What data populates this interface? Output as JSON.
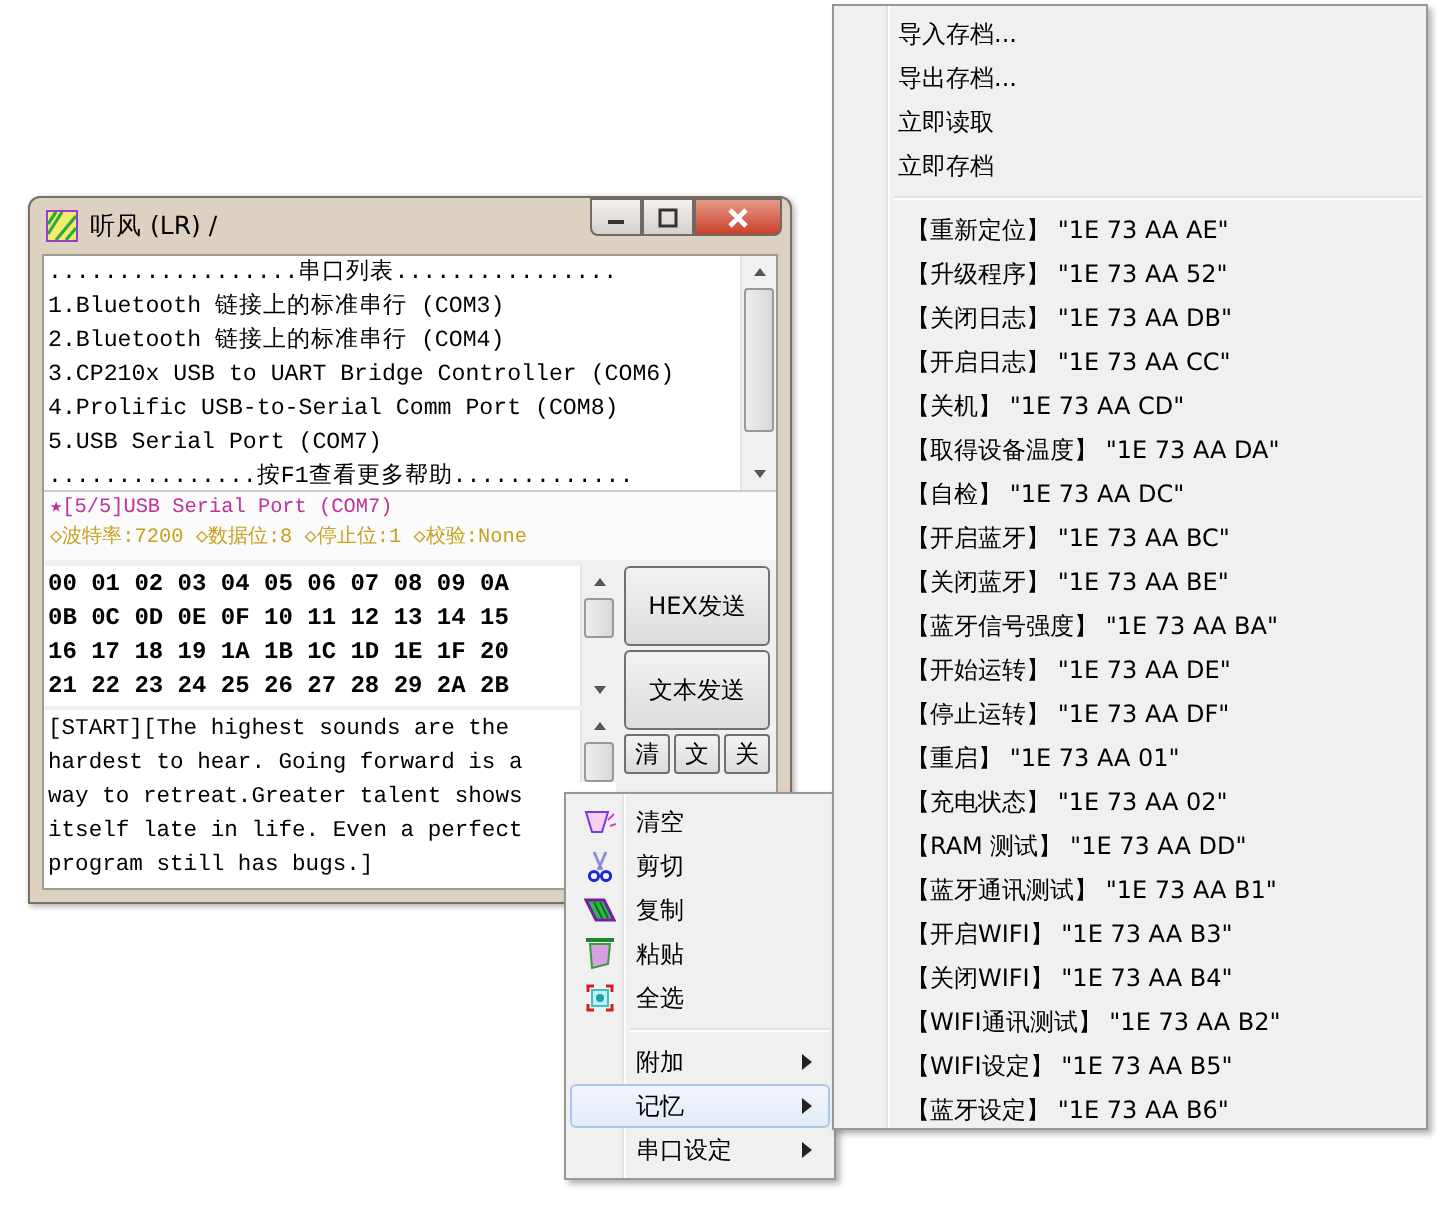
{
  "window": {
    "title": "听风 (LR)  /",
    "port_list": {
      "lines": [
        "..................串口列表................",
        "1.Bluetooth 链接上的标准串行 (COM3)",
        "2.Bluetooth 链接上的标准串行 (COM4)",
        "3.CP210x USB to UART Bridge Controller (COM6)",
        "4.Prolific USB-to-Serial Comm Port (COM8)",
        "5.USB Serial Port (COM7)",
        "...............按F1查看更多帮助............."
      ]
    },
    "status": {
      "port": "★[5/5]USB Serial Port (COM7)",
      "params": "◇波特率:7200 ◇数据位:8 ◇停止位:1 ◇校验:None"
    },
    "hex_box": {
      "lines": [
        "00 01 02 03 04 05 06 07 08 09 0A",
        "0B 0C 0D 0E 0F 10 11 12 13 14 15",
        "16 17 18 19 1A 1B 1C 1D 1E 1F 20",
        "21 22 23 24 25 26 27 28 29 2A 2B"
      ]
    },
    "text_box": {
      "text": "[START][The highest sounds are the hardest to hear. Going forward is a way to retreat.Greater talent shows itself late in life. Even a perfect program still has bugs.]"
    },
    "send_buttons": [
      {
        "label": "HEX发送"
      },
      {
        "label": "文本发送"
      }
    ],
    "small_buttons": [
      {
        "label": "清"
      },
      {
        "label": "文"
      },
      {
        "label": "关"
      }
    ]
  },
  "context_menu": {
    "items": [
      {
        "label": "清空",
        "kind": "action",
        "selected": false
      },
      {
        "label": "剪切",
        "kind": "action",
        "selected": false
      },
      {
        "label": "复制",
        "kind": "action",
        "selected": false
      },
      {
        "label": "粘贴",
        "kind": "action",
        "selected": false
      },
      {
        "label": "全选",
        "kind": "action",
        "selected": false
      },
      {
        "kind": "separator"
      },
      {
        "label": "附加",
        "kind": "submenu",
        "selected": false
      },
      {
        "label": "记忆",
        "kind": "submenu",
        "selected": true
      },
      {
        "label": "串口设定",
        "kind": "submenu",
        "selected": false
      }
    ]
  },
  "submenu": {
    "items": [
      {
        "label": "导入存档...",
        "kind": "plain"
      },
      {
        "label": "导出存档...",
        "kind": "plain"
      },
      {
        "label": "立即读取",
        "kind": "plain"
      },
      {
        "label": "立即存档",
        "kind": "plain"
      },
      {
        "kind": "separator"
      },
      {
        "label": "【重新定位】 \"1E 73 AA AE\"",
        "kind": "command"
      },
      {
        "label": "【升级程序】 \"1E 73 AA 52\"",
        "kind": "command"
      },
      {
        "label": "【关闭日志】 \"1E 73 AA DB\"",
        "kind": "command"
      },
      {
        "label": "【开启日志】 \"1E 73 AA CC\"",
        "kind": "command"
      },
      {
        "label": "【关机】 \"1E 73 AA CD\"",
        "kind": "command"
      },
      {
        "label": "【取得设备温度】 \"1E 73 AA DA\"",
        "kind": "command"
      },
      {
        "label": "【自检】 \"1E 73 AA DC\"",
        "kind": "command"
      },
      {
        "label": "【开启蓝牙】 \"1E 73 AA BC\"",
        "kind": "command"
      },
      {
        "label": "【关闭蓝牙】 \"1E 73 AA BE\"",
        "kind": "command"
      },
      {
        "label": "【蓝牙信号强度】 \"1E 73 AA BA\"",
        "kind": "command"
      },
      {
        "label": "【开始运转】 \"1E 73 AA DE\"",
        "kind": "command"
      },
      {
        "label": "【停止运转】 \"1E 73 AA DF\"",
        "kind": "command"
      },
      {
        "label": "【重启】 \"1E 73 AA 01\"",
        "kind": "command"
      },
      {
        "label": "【充电状态】 \"1E 73 AA 02\"",
        "kind": "command"
      },
      {
        "label": "【RAM 测试】 \"1E 73 AA DD\"",
        "kind": "command"
      },
      {
        "label": "【蓝牙通讯测试】 \"1E 73 AA B1\"",
        "kind": "command"
      },
      {
        "label": "【开启WIFI】 \"1E 73 AA B3\"",
        "kind": "command"
      },
      {
        "label": "【关闭WIFI】 \"1E 73 AA B4\"",
        "kind": "command"
      },
      {
        "label": "【WIFI通讯测试】 \"1E 73 AA B2\"",
        "kind": "command"
      },
      {
        "label": "【WIFI设定】 \"1E 73 AA B5\"",
        "kind": "command"
      },
      {
        "label": "【蓝牙设定】 \"1E 73 AA B6\"",
        "kind": "command"
      }
    ]
  }
}
